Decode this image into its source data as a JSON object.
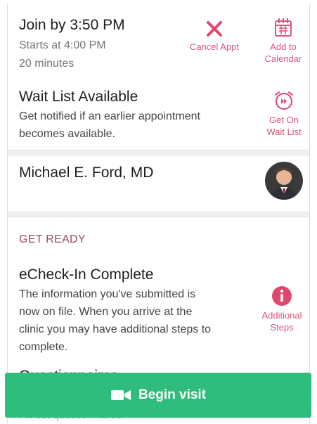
{
  "appointment": {
    "join_by": "Join by 3:50 PM",
    "starts_at": "Starts at 4:00 PM",
    "duration": "20 minutes",
    "cancel_label": "Cancel Appt",
    "calendar_label_1": "Add to",
    "calendar_label_2": "Calendar"
  },
  "waitlist": {
    "title": "Wait List Available",
    "line1": "Get notified if an earlier appointment",
    "line2": "becomes available.",
    "action_1": "Get On",
    "action_2": "Wait List"
  },
  "provider": {
    "name": "Michael E. Ford, MD"
  },
  "get_ready": {
    "heading": "GET READY",
    "echeckin_title": "eCheck-In Complete",
    "line1": "The information you've submitted is",
    "line2": "now on file. When you arrive at the",
    "line3": "clinic you may have additional steps to",
    "line4": "complete.",
    "action_1": "Additional",
    "action_2": "Steps",
    "questionnaires_title": "Questionnaires",
    "questionnaires_sub": "Fill out questionnaires."
  },
  "begin_visit": {
    "label": "Begin visit"
  },
  "colors": {
    "accent": "#d9557a",
    "section_heading": "#9a4a68",
    "button": "#2fbd7d"
  }
}
